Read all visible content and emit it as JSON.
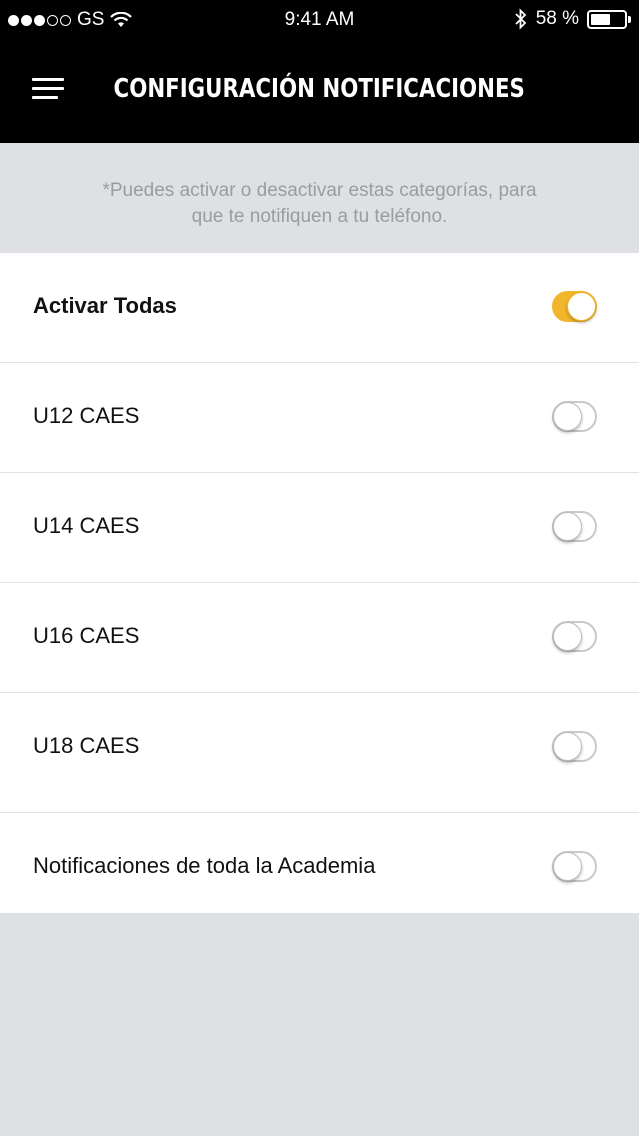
{
  "status_bar": {
    "carrier": "GS",
    "time": "9:41 AM",
    "battery_percent": "58 %",
    "battery_level": 0.58,
    "signal_bars": 3,
    "signal_total": 5
  },
  "header": {
    "title": "CONFIGURACIÓN NOTIFICACIONES",
    "menu_icon": "hamburger-menu-icon"
  },
  "notice": {
    "line1": "*Puedes activar o desactivar estas categorías, para",
    "line2": "que te notifiquen a tu teléfono."
  },
  "settings": {
    "items": [
      {
        "label": "Activar Todas",
        "on": true
      },
      {
        "label": "U12 CAES",
        "on": false
      },
      {
        "label": "U14 CAES",
        "on": false
      },
      {
        "label": "U16 CAES",
        "on": false
      },
      {
        "label": "U18 CAES",
        "on": false
      },
      {
        "label": "Notificaciones de toda la Academia",
        "on": false
      }
    ]
  },
  "colors": {
    "accent": "#f2b62c",
    "header_bg": "#000000",
    "page_bg": "#dfe0e4"
  }
}
